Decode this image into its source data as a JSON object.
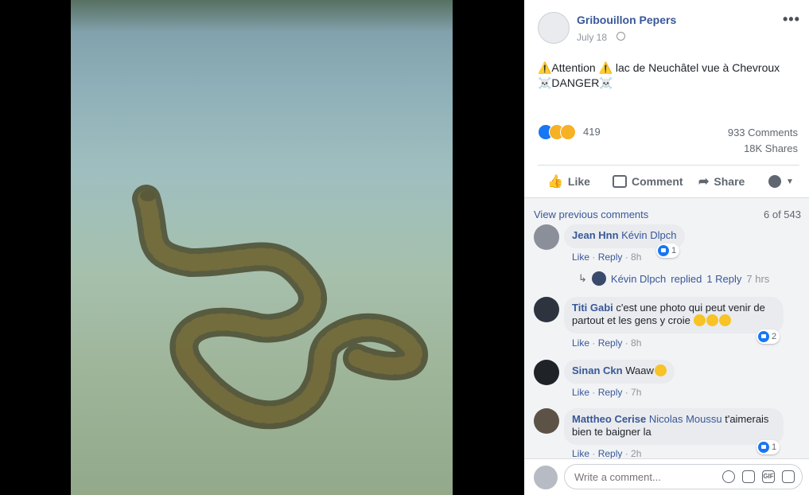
{
  "post": {
    "author": "Gribouillon Pepers",
    "date": "July 18",
    "more_glyph": "•••",
    "text_line1": "⚠️Attention ⚠️ lac de Neuchâtel vue à Chevroux",
    "text_line2": "☠️DANGER☠️",
    "reaction_count": "419",
    "comments_count": "933 Comments",
    "shares_count": "18K Shares"
  },
  "actions": {
    "like": "Like",
    "comment": "Comment",
    "share": "Share"
  },
  "comments": {
    "view_previous": "View previous comments",
    "page_count": "6 of 543",
    "items": [
      {
        "name": "Jean Hnn",
        "mention": "Kévin Dlpch",
        "text": "",
        "like": "Like",
        "reply": "Reply",
        "time": "8h",
        "reactions": "1"
      },
      {
        "name": "Titi Gabi",
        "mention": "",
        "text_line1": "c'est une photo qui peut venir de",
        "text_line2": "partout et les gens y croie",
        "like": "Like",
        "reply": "Reply",
        "time": "8h",
        "reactions": "2"
      },
      {
        "name": "Sinan Ckn",
        "mention": "",
        "text": "Waaw",
        "like": "Like",
        "reply": "Reply",
        "time": "7h"
      },
      {
        "name": "Mattheo Cerise",
        "mention": "Nicolas Moussu",
        "text_line1": "t'aimerais",
        "text_line2": "bien te baigner la",
        "like": "Like",
        "reply": "Reply",
        "time": "2h",
        "reactions": "1"
      }
    ],
    "reply_summary": {
      "name": "Kévin Dlpch",
      "verb": "replied",
      "link": "1 Reply",
      "time": "7 hrs"
    }
  },
  "write_comment": {
    "placeholder": "Write a comment..."
  },
  "colors": {
    "link": "#385898",
    "like_blue": "#1877f2",
    "muted": "#90949c"
  }
}
